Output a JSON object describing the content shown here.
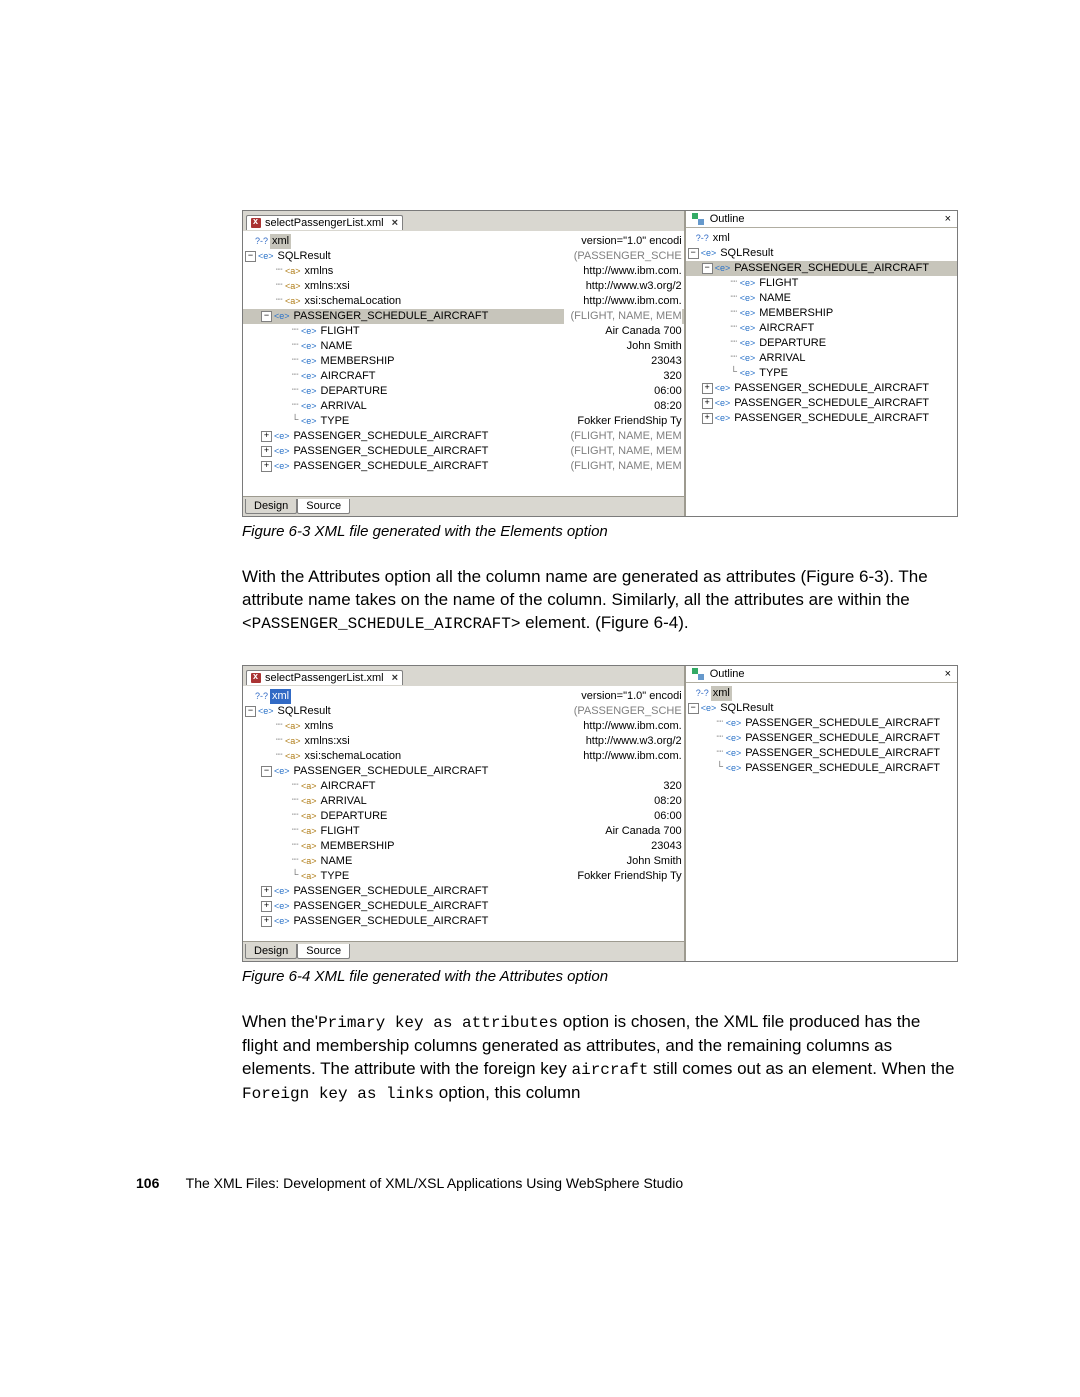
{
  "fig1": {
    "tab": "selectPassengerList.xml",
    "tree": [
      {
        "ind": 12,
        "tw": "",
        "exp": "",
        "ic": "xml",
        "t": "xml",
        "v": "version=\"1.0\" encodi",
        "sel": 1
      },
      {
        "ind": 0,
        "tw": "",
        "exp": "-",
        "ic": "e",
        "t": "SQLResult",
        "v": "(PASSENGER_SCHE",
        "vg": 1
      },
      {
        "ind": 30,
        "tw": "┈",
        "exp": "",
        "ic": "a",
        "t": "xmlns",
        "v": "http://www.ibm.com."
      },
      {
        "ind": 30,
        "tw": "┈",
        "exp": "",
        "ic": "a",
        "t": "xmlns:xsi",
        "v": "http://www.w3.org/2"
      },
      {
        "ind": 30,
        "tw": "┈",
        "exp": "",
        "ic": "a",
        "t": "xsi:schemaLocation",
        "v": "http://www.ibm.com."
      },
      {
        "ind": 16,
        "tw": "",
        "exp": "-",
        "ic": "e",
        "t": "PASSENGER_SCHEDULE_AIRCRAFT",
        "v": "(FLIGHT, NAME, MEM",
        "vg": 1,
        "sel": 2
      },
      {
        "ind": 46,
        "tw": "┈",
        "exp": "",
        "ic": "e",
        "t": "FLIGHT",
        "v": "Air Canada 700"
      },
      {
        "ind": 46,
        "tw": "┈",
        "exp": "",
        "ic": "e",
        "t": "NAME",
        "v": "John Smith"
      },
      {
        "ind": 46,
        "tw": "┈",
        "exp": "",
        "ic": "e",
        "t": "MEMBERSHIP",
        "v": "23043"
      },
      {
        "ind": 46,
        "tw": "┈",
        "exp": "",
        "ic": "e",
        "t": "AIRCRAFT",
        "v": "320"
      },
      {
        "ind": 46,
        "tw": "┈",
        "exp": "",
        "ic": "e",
        "t": "DEPARTURE",
        "v": "06:00"
      },
      {
        "ind": 46,
        "tw": "┈",
        "exp": "",
        "ic": "e",
        "t": "ARRIVAL",
        "v": "08:20"
      },
      {
        "ind": 46,
        "tw": "└",
        "exp": "",
        "ic": "e",
        "t": "TYPE",
        "v": "Fokker FriendShip Ty"
      },
      {
        "ind": 16,
        "tw": "",
        "exp": "+",
        "ic": "e",
        "t": "PASSENGER_SCHEDULE_AIRCRAFT",
        "v": "(FLIGHT, NAME, MEM",
        "vg": 1
      },
      {
        "ind": 16,
        "tw": "",
        "exp": "+",
        "ic": "e",
        "t": "PASSENGER_SCHEDULE_AIRCRAFT",
        "v": "(FLIGHT, NAME, MEM",
        "vg": 1
      },
      {
        "ind": 16,
        "tw": "",
        "exp": "+",
        "ic": "e",
        "t": "PASSENGER_SCHEDULE_AIRCRAFT",
        "v": "(FLIGHT, NAME, MEM",
        "vg": 1
      }
    ],
    "outline_title": "Outline",
    "outline": [
      {
        "ind": 10,
        "tw": "",
        "exp": "",
        "ic": "xml",
        "t": "xml"
      },
      {
        "ind": 0,
        "tw": "",
        "exp": "-",
        "ic": "e",
        "t": "SQLResult"
      },
      {
        "ind": 14,
        "tw": "",
        "exp": "-",
        "ic": "e",
        "t": "PASSENGER_SCHEDULE_AIRCRAFT",
        "sel": 2
      },
      {
        "ind": 42,
        "tw": "┈",
        "exp": "",
        "ic": "e",
        "t": "FLIGHT"
      },
      {
        "ind": 42,
        "tw": "┈",
        "exp": "",
        "ic": "e",
        "t": "NAME"
      },
      {
        "ind": 42,
        "tw": "┈",
        "exp": "",
        "ic": "e",
        "t": "MEMBERSHIP"
      },
      {
        "ind": 42,
        "tw": "┈",
        "exp": "",
        "ic": "e",
        "t": "AIRCRAFT"
      },
      {
        "ind": 42,
        "tw": "┈",
        "exp": "",
        "ic": "e",
        "t": "DEPARTURE"
      },
      {
        "ind": 42,
        "tw": "┈",
        "exp": "",
        "ic": "e",
        "t": "ARRIVAL"
      },
      {
        "ind": 42,
        "tw": "└",
        "exp": "",
        "ic": "e",
        "t": "TYPE"
      },
      {
        "ind": 14,
        "tw": "",
        "exp": "+",
        "ic": "e",
        "t": "PASSENGER_SCHEDULE_AIRCRAFT"
      },
      {
        "ind": 14,
        "tw": "",
        "exp": "+",
        "ic": "e",
        "t": "PASSENGER_SCHEDULE_AIRCRAFT"
      },
      {
        "ind": 14,
        "tw": "",
        "exp": "+",
        "ic": "e",
        "t": "PASSENGER_SCHEDULE_AIRCRAFT"
      }
    ],
    "bottom": [
      "Design",
      "Source"
    ]
  },
  "cap1": "Figure 6-3   XML file generated with the Elements option",
  "para1a": "With the Attributes option all the column name are generated as attributes (Figure 6-3). The attribute name takes on the name of the column. Similarly, all the attributes are within the ",
  "para1b": "<PASSENGER_SCHEDULE_AIRCRAFT>",
  "para1c": " element. (Figure 6-4).",
  "fig2": {
    "tab": "selectPassengerList.xml",
    "tree": [
      {
        "ind": 12,
        "tw": "",
        "exp": "",
        "ic": "xml",
        "t": "xml",
        "v": "version=\"1.0\" encodi",
        "sel": 3
      },
      {
        "ind": 0,
        "tw": "",
        "exp": "-",
        "ic": "e",
        "t": "SQLResult",
        "v": "(PASSENGER_SCHE",
        "vg": 1
      },
      {
        "ind": 30,
        "tw": "┈",
        "exp": "",
        "ic": "a",
        "t": "xmlns",
        "v": "http://www.ibm.com."
      },
      {
        "ind": 30,
        "tw": "┈",
        "exp": "",
        "ic": "a",
        "t": "xmlns:xsi",
        "v": "http://www.w3.org/2"
      },
      {
        "ind": 30,
        "tw": "┈",
        "exp": "",
        "ic": "a",
        "t": "xsi:schemaLocation",
        "v": "http://www.ibm.com."
      },
      {
        "ind": 16,
        "tw": "",
        "exp": "-",
        "ic": "e",
        "t": "PASSENGER_SCHEDULE_AIRCRAFT",
        "v": ""
      },
      {
        "ind": 46,
        "tw": "┈",
        "exp": "",
        "ic": "a",
        "t": "AIRCRAFT",
        "v": "320"
      },
      {
        "ind": 46,
        "tw": "┈",
        "exp": "",
        "ic": "a",
        "t": "ARRIVAL",
        "v": "08:20"
      },
      {
        "ind": 46,
        "tw": "┈",
        "exp": "",
        "ic": "a",
        "t": "DEPARTURE",
        "v": "06:00"
      },
      {
        "ind": 46,
        "tw": "┈",
        "exp": "",
        "ic": "a",
        "t": "FLIGHT",
        "v": "Air Canada 700"
      },
      {
        "ind": 46,
        "tw": "┈",
        "exp": "",
        "ic": "a",
        "t": "MEMBERSHIP",
        "v": "23043"
      },
      {
        "ind": 46,
        "tw": "┈",
        "exp": "",
        "ic": "a",
        "t": "NAME",
        "v": "John Smith"
      },
      {
        "ind": 46,
        "tw": "└",
        "exp": "",
        "ic": "a",
        "t": "TYPE",
        "v": "Fokker FriendShip Ty"
      },
      {
        "ind": 16,
        "tw": "",
        "exp": "+",
        "ic": "e",
        "t": "PASSENGER_SCHEDULE_AIRCRAFT",
        "v": ""
      },
      {
        "ind": 16,
        "tw": "",
        "exp": "+",
        "ic": "e",
        "t": "PASSENGER_SCHEDULE_AIRCRAFT",
        "v": ""
      },
      {
        "ind": 16,
        "tw": "",
        "exp": "+",
        "ic": "e",
        "t": "PASSENGER_SCHEDULE_AIRCRAFT",
        "v": ""
      }
    ],
    "outline_title": "Outline",
    "outline": [
      {
        "ind": 10,
        "tw": "",
        "exp": "",
        "ic": "xml",
        "t": "xml",
        "sel": 1
      },
      {
        "ind": 0,
        "tw": "",
        "exp": "-",
        "ic": "e",
        "t": "SQLResult"
      },
      {
        "ind": 28,
        "tw": "┈",
        "exp": "",
        "ic": "e",
        "t": "PASSENGER_SCHEDULE_AIRCRAFT"
      },
      {
        "ind": 28,
        "tw": "┈",
        "exp": "",
        "ic": "e",
        "t": "PASSENGER_SCHEDULE_AIRCRAFT"
      },
      {
        "ind": 28,
        "tw": "┈",
        "exp": "",
        "ic": "e",
        "t": "PASSENGER_SCHEDULE_AIRCRAFT"
      },
      {
        "ind": 28,
        "tw": "└",
        "exp": "",
        "ic": "e",
        "t": "PASSENGER_SCHEDULE_AIRCRAFT"
      }
    ],
    "bottom": [
      "Design",
      "Source"
    ]
  },
  "cap2": "Figure 6-4   XML file generated with the Attributes option",
  "para2a": "When the'",
  "para2b": "Primary key as attributes",
  "para2c": " option is chosen, the XML file produced has the flight and membership columns generated as attributes, and the remaining columns as elements. The attribute with the foreign key ",
  "para2d": "aircraft",
  "para2e": " still comes out as an element. When the ",
  "para2f": "Foreign key as links",
  "para2g": " option, this column",
  "footer": {
    "page": "106",
    "text": "The XML Files:  Development of XML/XSL Applications Using WebSphere Studio"
  }
}
